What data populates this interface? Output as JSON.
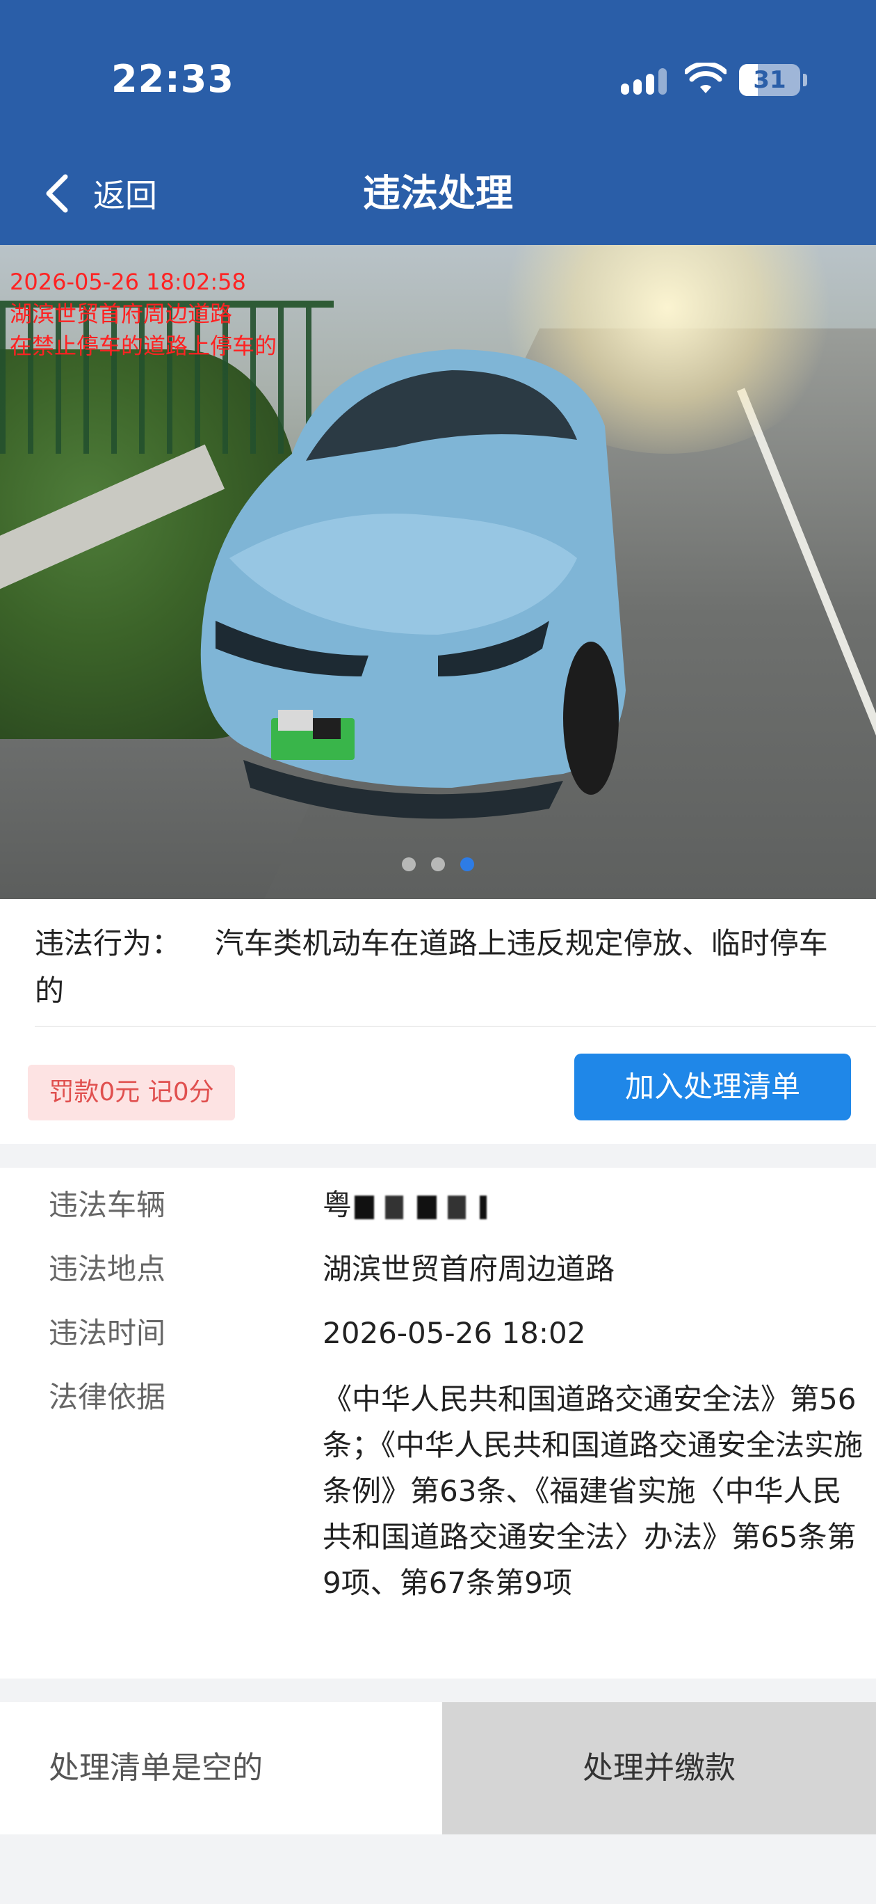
{
  "status_bar": {
    "time": "22:33",
    "battery": "31",
    "battery_level": 0.31,
    "icons": [
      "signal-icon",
      "wifi-icon",
      "battery-icon"
    ]
  },
  "nav": {
    "back_label": "返回",
    "title": "违法处理",
    "back_icon": "chevron-left-icon"
  },
  "photo": {
    "caption_lines": [
      "2026-05-26 18:02:58",
      "湖滨世贸首府周边道路",
      "在禁止停车的道路上停车的"
    ],
    "slide_count": 3,
    "active_slide": 3
  },
  "violation": {
    "behavior_label": "违法行为：",
    "behavior_text": "汽车类机动车在道路上违反规定停放、临时停车的",
    "penalty": "罚款0元 记0分",
    "add_button": "加入处理清单"
  },
  "details": {
    "vehicle_label": "违法车辆",
    "vehicle_value": "粤",
    "location_label": "违法地点",
    "location_value": "湖滨世贸首府周边道路",
    "time_label": "违法时间",
    "time_value": "2026-05-26 18:02",
    "basis_label": "法律依据",
    "basis_value": "《中华人民共和国道路交通安全法》第56条；《中华人民共和国道路交通安全法实施条例》第63条、《福建省实施〈中华人民共和国道路交通安全法〉办法》第65条第9项、第67条第9项"
  },
  "bottom": {
    "list_status": "处理清单是空的",
    "pay_button": "处理并缴款"
  },
  "colors": {
    "header": "#2a5ea8",
    "primary_button": "#1f87e8",
    "penalty_bg": "#fde3e3",
    "penalty_text": "#e0504f",
    "caption_red": "#ff2222"
  }
}
